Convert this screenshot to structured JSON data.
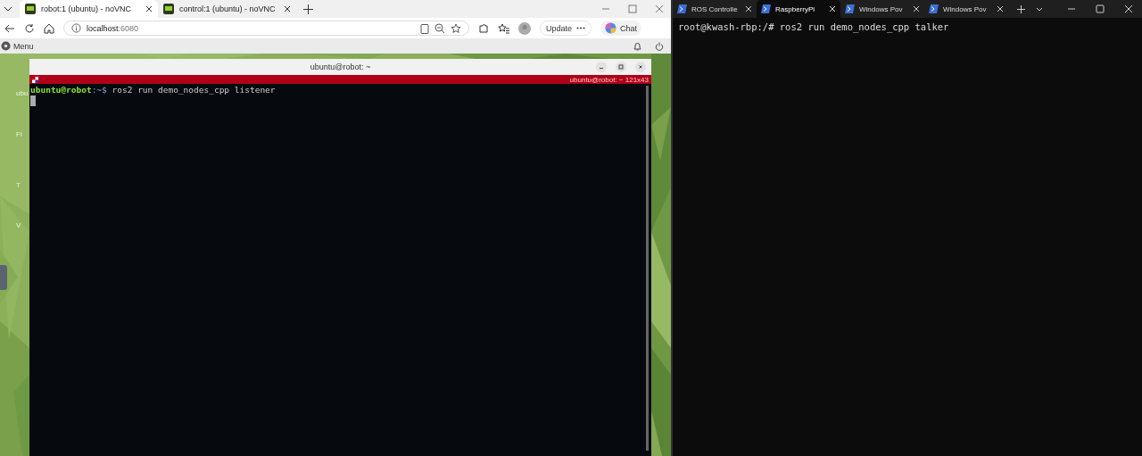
{
  "browser": {
    "tabs": [
      {
        "title": "robot:1 (ubuntu) - noVNC",
        "selected": true
      },
      {
        "title": "control:1 (ubuntu) - noVNC",
        "selected": false
      }
    ],
    "address": {
      "host": "localhost",
      "port": ":6080"
    },
    "update_button": "Update",
    "chat_button": "Chat"
  },
  "desktop": {
    "menu_label": "Menu",
    "icon_labels": [
      "ubu",
      "Fi",
      "T",
      "V"
    ],
    "terminal": {
      "title": "ubuntu@robot: ~",
      "subtitle": "ubuntu@robot: ~ 121x43",
      "prompt_user": "ubuntu@robot",
      "prompt_path": ":~$",
      "command": " ros2 run demo_nodes_cpp listener"
    }
  },
  "windows_terminal": {
    "tabs": [
      {
        "title": "ROS Controlle",
        "selected": false
      },
      {
        "title": "RaspberryPi",
        "selected": true
      },
      {
        "title": "Windows Pov",
        "selected": false
      },
      {
        "title": "Windows Pov",
        "selected": false
      }
    ],
    "line": "root@kwash-rbp:/# ros2 run demo_nodes_cpp talker"
  }
}
